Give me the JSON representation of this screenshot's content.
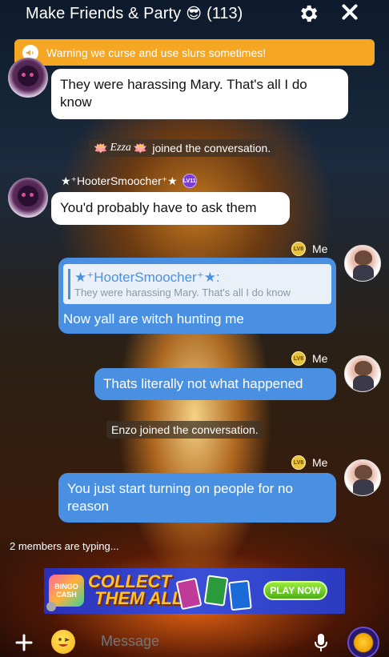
{
  "header": {
    "title": "Make Friends & Party",
    "emoji": "😎",
    "count": "(113)",
    "settings_icon": "gear-icon",
    "close_icon": "close-icon"
  },
  "warning": {
    "icon": "megaphone-icon",
    "text": "Warning we curse and use slurs sometimes!"
  },
  "messages": [
    {
      "kind": "received",
      "text": "They were harassing Mary. That's all I do know"
    },
    {
      "kind": "system",
      "prefix": "🪷",
      "name": "Ezza",
      "suffix": "🪷",
      "text": "joined the conversation."
    },
    {
      "kind": "received",
      "sender": "★⁺HooterSmoocher⁺★",
      "level": "LV11",
      "text": "You'd probably have to ask them"
    },
    {
      "kind": "sent",
      "sender": "Me",
      "level": "LV8",
      "quote_name": "★⁺HooterSmoocher⁺★:",
      "quote_text": "They were harassing Mary. That's all I do know",
      "text": "Now yall are witch hunting me"
    },
    {
      "kind": "sent",
      "sender": "Me",
      "level": "LV8",
      "text": "Thats literally not what happened"
    },
    {
      "kind": "system",
      "text": "Enzo joined the conversation."
    },
    {
      "kind": "sent",
      "sender": "Me",
      "level": "LV8",
      "text": "You just start turning on people for no reason"
    }
  ],
  "typing": "2 members are typing...",
  "ad": {
    "logo_text": "BINGO CASH",
    "headline_line1": "COLLECT",
    "headline_line2": "THEM ALL",
    "cta": "PLAY NOW"
  },
  "input": {
    "placeholder": "Message"
  },
  "colors": {
    "warning": "#f5a623",
    "sent_bubble": "#4a90e2",
    "received_bubble": "#ffffff"
  }
}
